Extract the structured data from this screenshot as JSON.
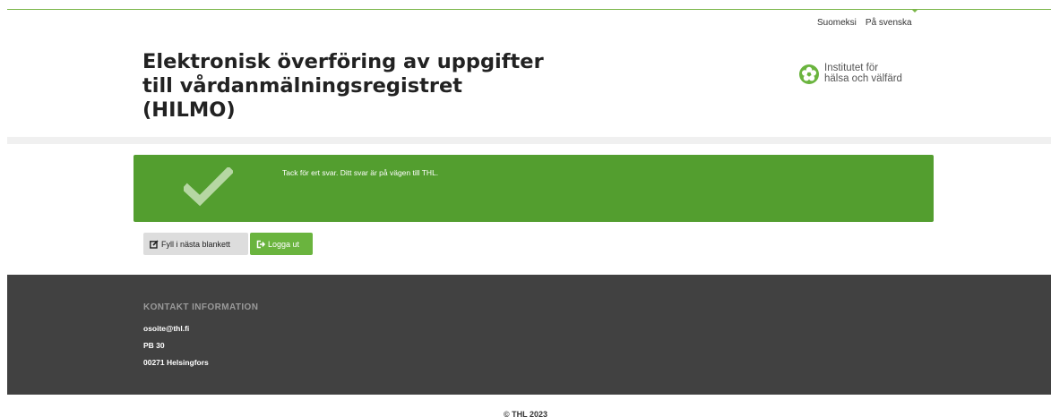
{
  "header": {
    "languages": [
      "Suomeksi",
      "På svenska"
    ],
    "title": "Elektronisk överföring av uppgifter till vårdanmälningsregistret (HILMO)",
    "logo_line1": "Institutet för",
    "logo_line2": "hälsa och välfärd"
  },
  "alert": {
    "message": "Tack för ert svar. Ditt svar är på vägen till THL."
  },
  "actions": {
    "next_form_label": "Fyll i nästa blankett",
    "logout_label": "Logga ut"
  },
  "footer": {
    "heading": "KONTAKT INFORMATION",
    "email": "osoite@thl.fi",
    "po_box": "PB 30",
    "postal": "00271 Helsingfors",
    "copyright": "© THL 2023"
  },
  "colors": {
    "accent_green": "#6ab43e",
    "alert_green": "#539e2f",
    "footer_bg": "#414141"
  }
}
